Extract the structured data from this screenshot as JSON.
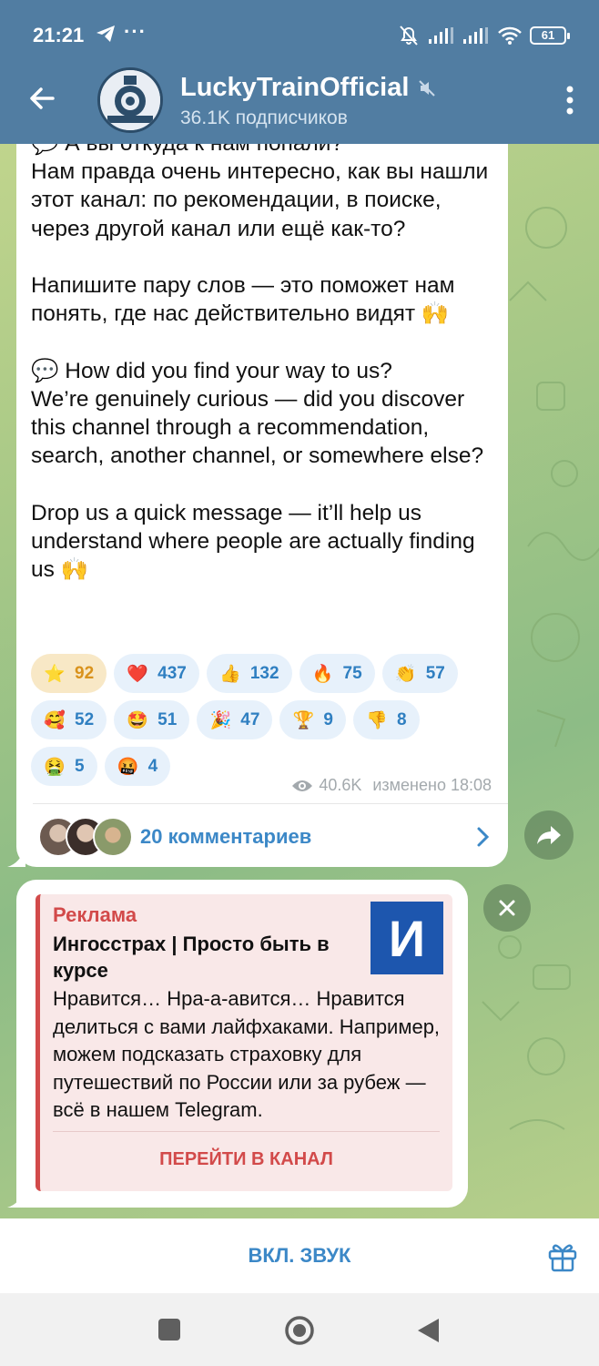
{
  "status": {
    "time": "21:21",
    "more": "···",
    "battery": "61"
  },
  "header": {
    "title": "LuckyTrainOfficial",
    "subtitle": "36.1K подписчиков"
  },
  "post": {
    "text": "💬 А вы откуда к нам попали?\nНам правда очень интересно, как вы нашли этот канал: по рекомендации, в поиске, через другой канал или ещё как-то?\n\nНапишите пару слов — это поможет нам понять, где нас действительно видят 🙌\n\n💬 How did you find your way to us?\nWe’re genuinely curious — did you discover this channel through a recommendation, search, another channel, or somewhere else?\n\nDrop us a quick message — it’ll help us understand where people are actually finding us 🙌",
    "reactions": [
      {
        "emoji": "⭐",
        "count": "92",
        "active": true
      },
      {
        "emoji": "❤️",
        "count": "437"
      },
      {
        "emoji": "👍",
        "count": "132"
      },
      {
        "emoji": "🔥",
        "count": "75"
      },
      {
        "emoji": "👏",
        "count": "57"
      },
      {
        "emoji": "🥰",
        "count": "52"
      },
      {
        "emoji": "🤩",
        "count": "51"
      },
      {
        "emoji": "🎉",
        "count": "47"
      },
      {
        "emoji": "🏆",
        "count": "9"
      },
      {
        "emoji": "👎",
        "count": "8"
      },
      {
        "emoji": "🤮",
        "count": "5"
      },
      {
        "emoji": "🤬",
        "count": "4"
      }
    ],
    "views": "40.6K",
    "edited": "изменено 18:08",
    "comments": "20 комментариев"
  },
  "ad": {
    "label": "Реклама",
    "title": "Ингосстрах | Просто быть в курсе",
    "body": "Нравится… Нра-а-авится… Нравится делиться с вами лайфхаками. Например, можем подсказать страховку для путешествий по России или за рубеж — всё в нашем Telegram.",
    "logo_letter": "И",
    "cta": "ПЕРЕЙТИ В КАНАЛ"
  },
  "bottom": {
    "unmute": "ВКЛ. ЗВУК"
  },
  "colors": {
    "header": "#517da2",
    "accent": "#3c88c7",
    "ad_accent": "#d24a4a",
    "star_reaction": "#d9921c"
  },
  "icons": [
    "telegram-icon",
    "mute-bell-icon",
    "signal-icon",
    "wifi-icon",
    "battery-icon",
    "back-arrow-icon",
    "muted-speaker-icon",
    "menu-dots-icon",
    "eye-icon",
    "chevron-right-icon",
    "share-icon",
    "close-icon",
    "gift-icon"
  ]
}
